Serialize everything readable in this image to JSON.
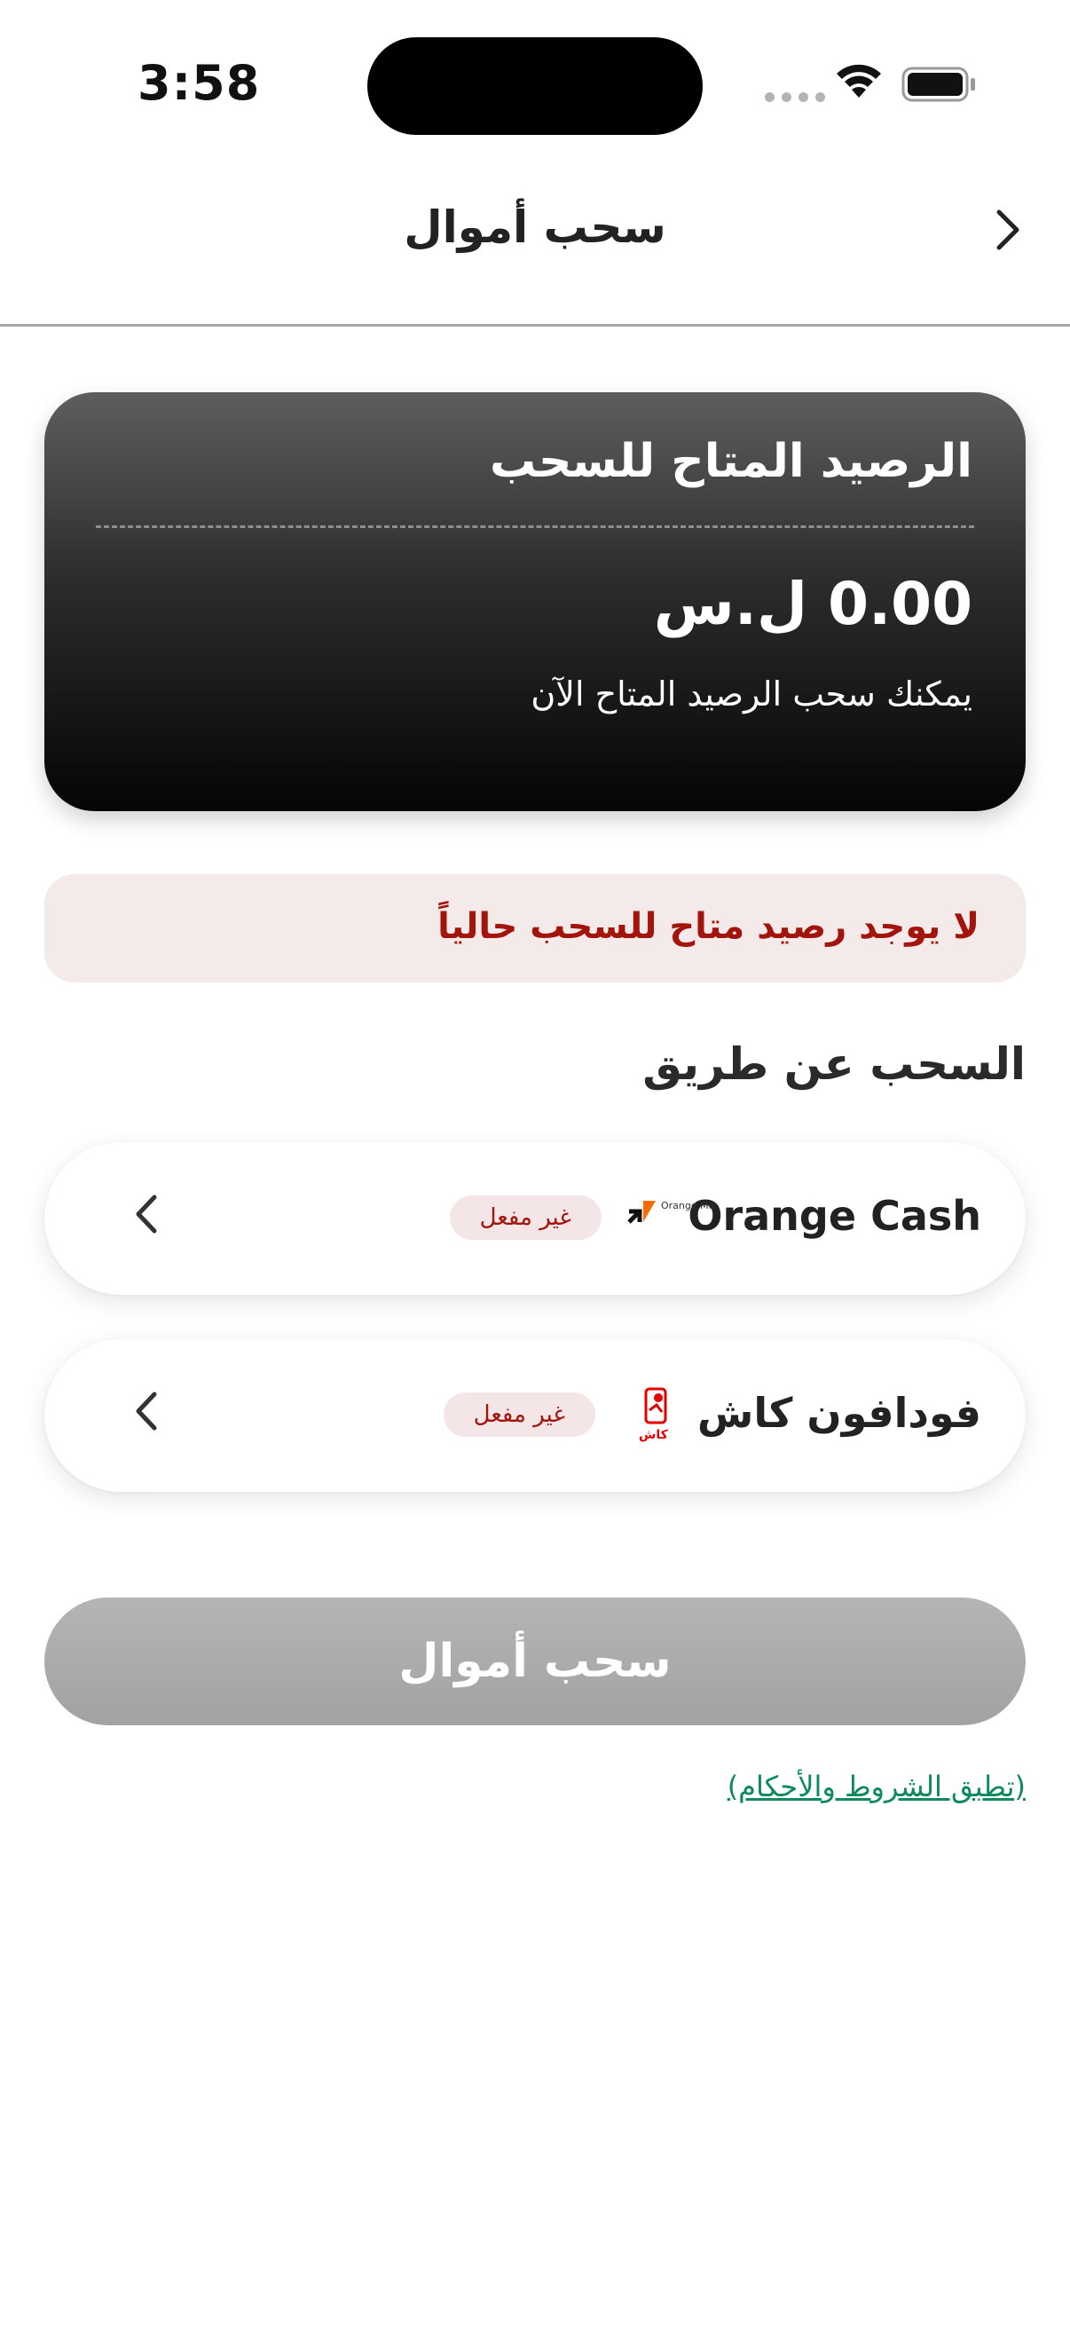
{
  "status_bar": {
    "time": "3:58"
  },
  "nav": {
    "title": "سحب أموال"
  },
  "balance_card": {
    "title": "الرصيد المتاح للسحب",
    "amount": "0.00 ل.س",
    "subtitle": "يمكنك سحب الرصيد المتاح الآن"
  },
  "alert": {
    "text": "لا يوجد رصيد متاح للسحب حالياً"
  },
  "methods_section": {
    "title": "السحب عن طريق",
    "methods": [
      {
        "name": "Orange Cash",
        "status": "غير مفعل",
        "logo_icon": "orange-money-logo",
        "logo_text": "Orange Money"
      },
      {
        "name": "فودافون كاش",
        "status": "غير مفعل",
        "logo_icon": "vodafone-cash-logo",
        "logo_text": "كاش"
      }
    ]
  },
  "withdraw_button": {
    "label": "سحب أموال"
  },
  "terms": {
    "text": "(تطبق الشروط والأحكام)"
  },
  "colors": {
    "alert_text": "#a3140c",
    "alert_bg": "#f5eaea",
    "badge_bg": "#f4e6e6",
    "button_disabled": "#aaaaaa",
    "link": "#0d8a5c",
    "card_dark": "#050505"
  }
}
